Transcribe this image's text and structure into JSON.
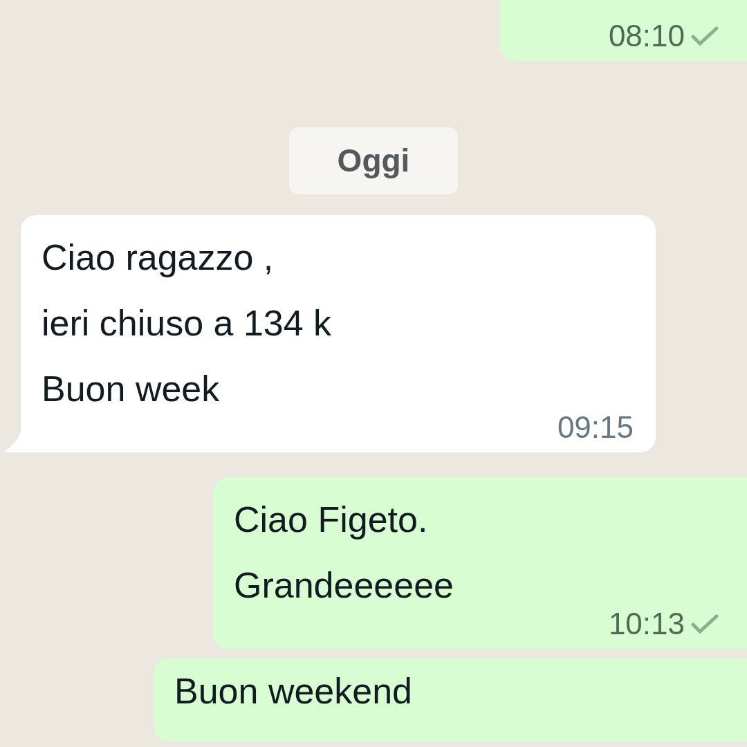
{
  "messages": [
    {
      "kind": "sent",
      "time": "08:10",
      "delivered": true
    },
    {
      "kind": "date",
      "text": "Oggi"
    },
    {
      "kind": "received",
      "text": "Ciao ragazzo ,\nieri chiuso a 134 k\nBuon week",
      "time": "09:15"
    },
    {
      "kind": "sent",
      "text": "Ciao Figeto.\nGrandeeeeee",
      "time": "10:13",
      "delivered": true
    },
    {
      "kind": "sent",
      "text": "Buon weekend"
    }
  ]
}
